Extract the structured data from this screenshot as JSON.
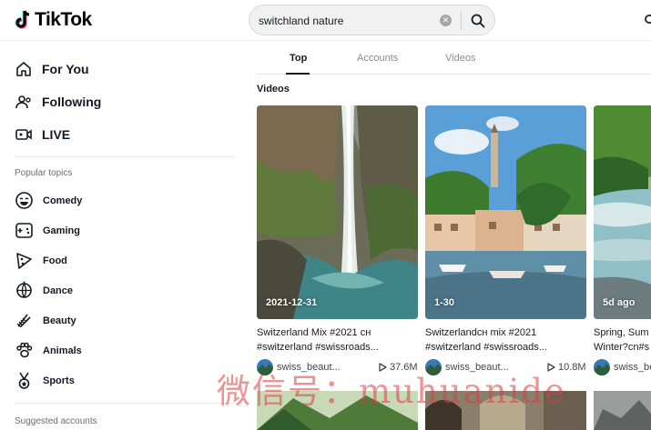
{
  "app": {
    "brand": "TikTok",
    "accent": "#fe2c55"
  },
  "search": {
    "value": "switchland nature",
    "placeholder": "Search"
  },
  "sidebar": {
    "nav": [
      {
        "label": "For You",
        "icon": "home-icon"
      },
      {
        "label": "Following",
        "icon": "following-icon"
      },
      {
        "label": "LIVE",
        "icon": "live-icon"
      }
    ],
    "popular_title": "Popular topics",
    "topics": [
      {
        "label": "Comedy",
        "icon": "comedy-icon"
      },
      {
        "label": "Gaming",
        "icon": "gaming-icon"
      },
      {
        "label": "Food",
        "icon": "food-icon"
      },
      {
        "label": "Dance",
        "icon": "dance-icon"
      },
      {
        "label": "Beauty",
        "icon": "beauty-icon"
      },
      {
        "label": "Animals",
        "icon": "animals-icon"
      },
      {
        "label": "Sports",
        "icon": "sports-icon"
      }
    ],
    "suggested_title": "Suggested accounts"
  },
  "tabs": [
    {
      "label": "Top",
      "active": true
    },
    {
      "label": "Accounts",
      "active": false
    },
    {
      "label": "Videos",
      "active": false
    }
  ],
  "results": {
    "section_title": "Videos",
    "videos": [
      {
        "date": "2021-12-31",
        "title": "Switzerland Mix #2021 ᴄʜ",
        "tags": "#switzerland #swissroads...",
        "user": "swiss_beaut...",
        "views": "37.6M"
      },
      {
        "date": "1-30",
        "title": "Switzerlandᴄʜ mix #2021",
        "tags": "#switzerland #swissroads...",
        "user": "swiss_beaut...",
        "views": "10.8M"
      },
      {
        "date": "5d ago",
        "title": "Spring, Sum",
        "tags": "Winter?cn#s",
        "user": "swiss_be",
        "views": ""
      }
    ]
  },
  "watermark": "微信号：muhuanide"
}
